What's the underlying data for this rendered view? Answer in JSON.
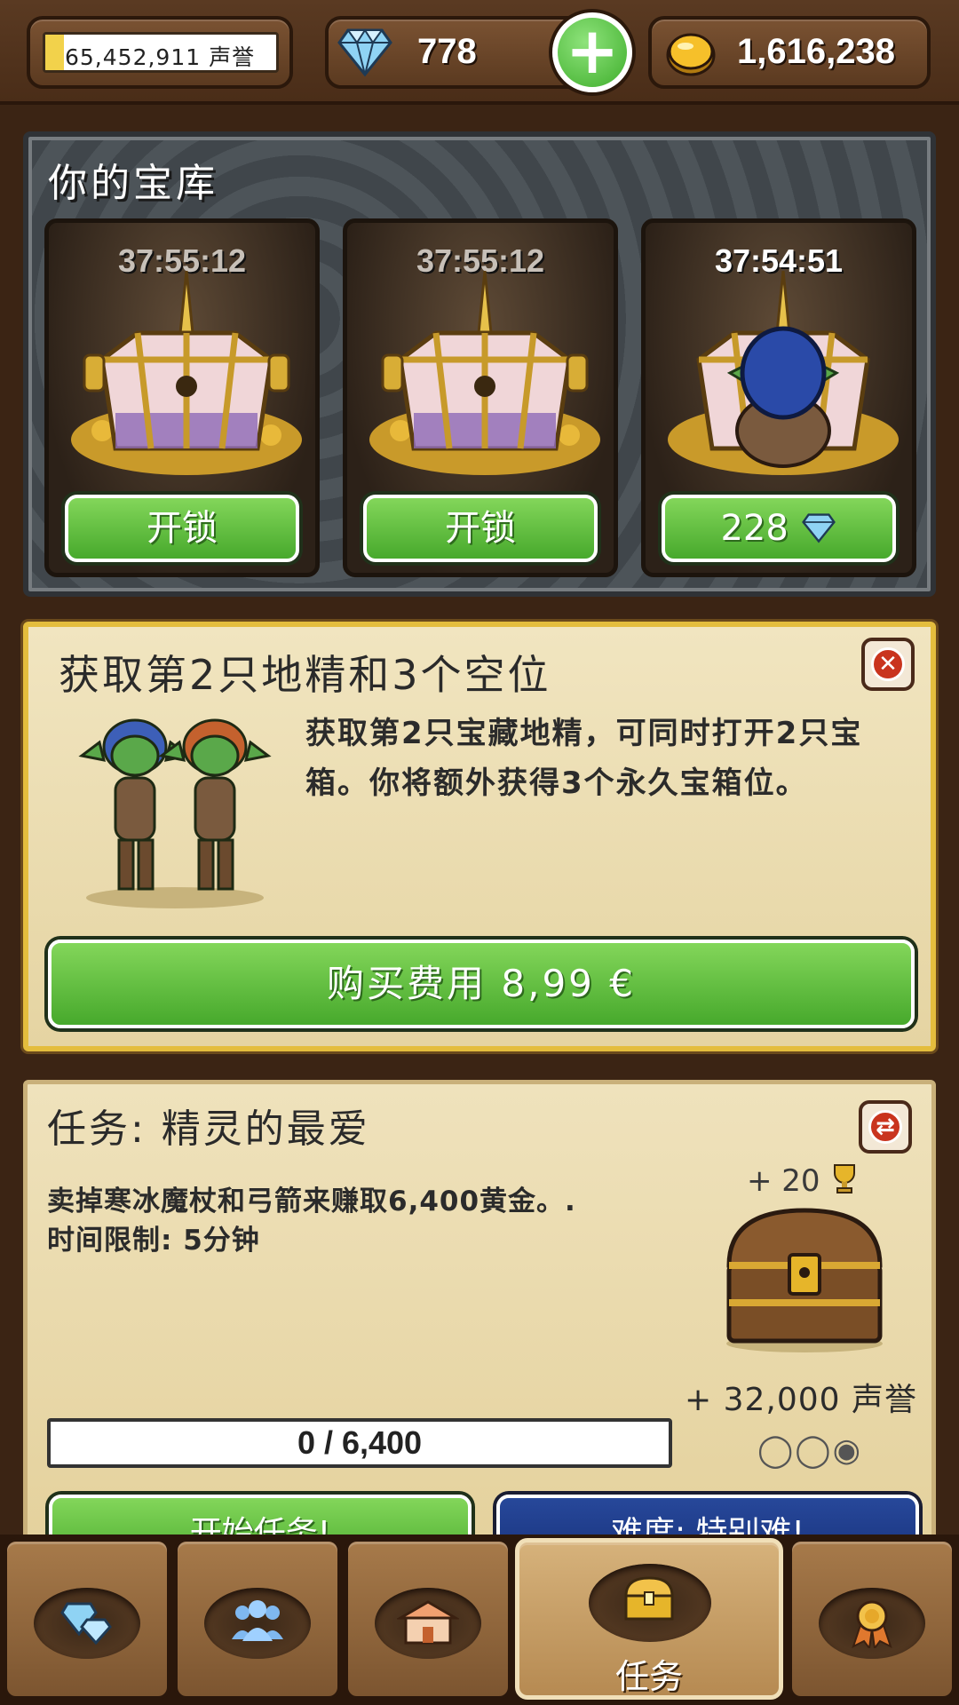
{
  "top": {
    "reputation_text": "65,452,911 声誉",
    "reputation_progress": 0.08,
    "gems": "778",
    "gold": "1,616,238",
    "add_label": "+"
  },
  "vault": {
    "title": "你的宝库",
    "chests": [
      {
        "timer": "37:55:12",
        "button": "开锁",
        "has_gnome": false
      },
      {
        "timer": "37:55:12",
        "button": "开锁",
        "has_gnome": false
      },
      {
        "timer": "37:54:51",
        "button": "228",
        "has_gnome": true
      }
    ]
  },
  "offer": {
    "title": "获取第2只地精和3个空位",
    "description": "获取第2只宝藏地精，可同时打开2只宝箱。你将额外获得3个永久宝箱位。",
    "buy_label": "购买费用 8,99 €"
  },
  "quest": {
    "title": "任务: 精灵的最爱",
    "description": "卖掉寒冰魔杖和弓箭来赚取6,400黄金。.",
    "time_limit": "时间限制: 5分钟",
    "trophy_reward": "+ 20",
    "rep_reward": "+ 32,000 声誉",
    "difficulty_marks": "◯◯◉",
    "progress_text": "0 / 6,400",
    "start_label": "开始任务!",
    "difficulty_label": "难度: 特别难!"
  },
  "nav": {
    "active_label": "任务",
    "tabs": [
      "gems-icon",
      "people-icon",
      "shop-icon",
      "chest-icon",
      "medal-icon"
    ]
  },
  "colors": {
    "green": "#47a92c",
    "gold_border": "#e4bd3d",
    "diamond": "#9ed8f5",
    "blue_button": "#17307a"
  }
}
